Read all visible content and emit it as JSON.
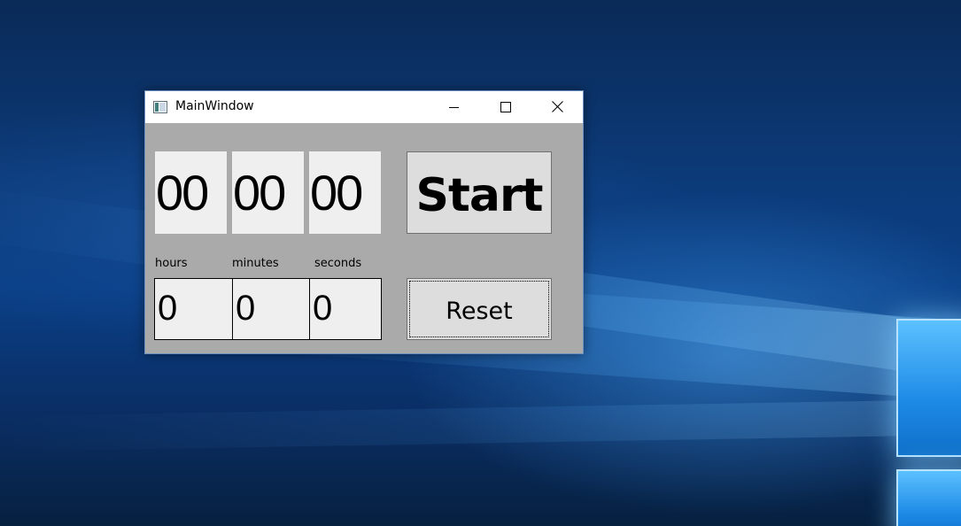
{
  "window": {
    "title": "MainWindow",
    "icon": "app-window-icon",
    "controls": {
      "minimize": "minimize-icon",
      "maximize": "maximize-icon",
      "close": "close-icon"
    }
  },
  "timer_display": {
    "hours": "00",
    "minutes": "00",
    "seconds": "00"
  },
  "labels": {
    "hours": "hours",
    "minutes": "minutes",
    "seconds": "seconds"
  },
  "inputs": {
    "hours": "0",
    "minutes": "0",
    "seconds": "0"
  },
  "buttons": {
    "start": "Start",
    "reset": "Reset"
  },
  "colors": {
    "window_background": "#aaaaaa",
    "display_background": "#efefef",
    "button_background": "#dddddd",
    "titlebar": "#ffffff"
  }
}
